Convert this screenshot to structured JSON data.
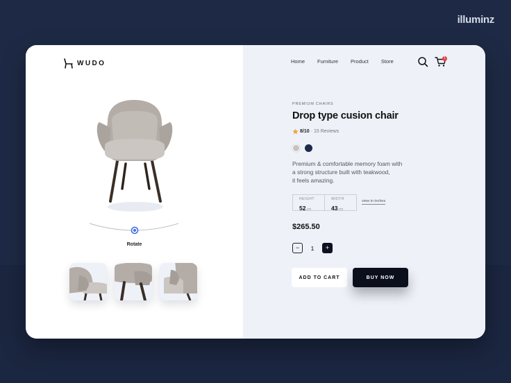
{
  "watermark": "illuminz",
  "brand": {
    "name": "WUDO"
  },
  "nav": {
    "links": [
      "Home",
      "Furniture",
      "Product",
      "Store"
    ]
  },
  "cart": {
    "badge": "1"
  },
  "product": {
    "category": "PREMIUM CHAIRS",
    "title": "Drop type cusion chair",
    "rating": {
      "score": "8/10",
      "separator": "·",
      "reviews": "15 Reviews"
    },
    "colors": [
      "#c7c2bd",
      "#1d2a48"
    ],
    "description": [
      "Premium & comfortable memory foam with",
      "a strong structure built with teakwood,",
      "it feels amazing."
    ],
    "dimensions": {
      "height": {
        "label": "HEIGHT",
        "value": "52",
        "unit": "cm"
      },
      "width": {
        "label": "WIDTH",
        "value": "43",
        "unit": "cm"
      },
      "link": "view in inches"
    },
    "price": "$265.50",
    "quantity": {
      "minus": "−",
      "value": "1",
      "plus": "+"
    },
    "actions": {
      "add_to_cart": "ADD TO CART",
      "buy_now": "BUY NOW"
    }
  },
  "viewer": {
    "rotate_label": "Rotate",
    "rotate_position": 0.51
  },
  "colors": {
    "background": "#1e2a45",
    "panel_right": "#eef1f8",
    "primary_dark": "#0b0f1c",
    "accent_blue": "#3b6fe0",
    "star": "#f4a236",
    "badge": "#e63946"
  },
  "icons": [
    "chair-logo-icon",
    "search-icon",
    "cart-icon",
    "star-icon"
  ]
}
